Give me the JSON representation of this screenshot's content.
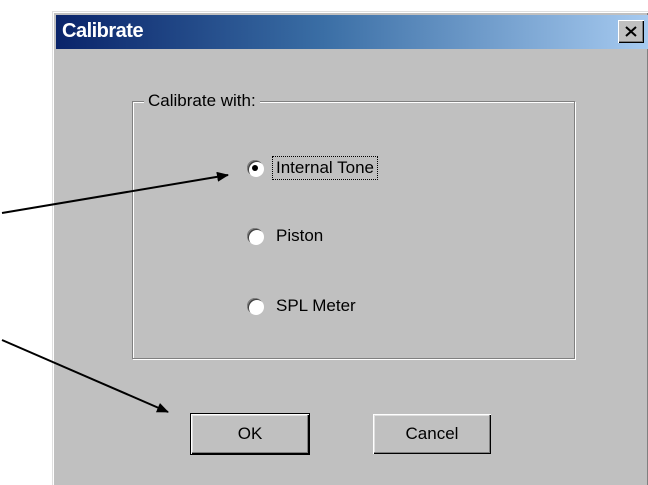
{
  "window": {
    "title": "Calibrate",
    "close_icon": "close-icon"
  },
  "group": {
    "label": "Calibrate with:",
    "options": [
      {
        "label": "Internal Tone",
        "selected": true
      },
      {
        "label": "Piston",
        "selected": false
      },
      {
        "label": "SPL Meter",
        "selected": false
      }
    ]
  },
  "buttons": {
    "ok_label": "OK",
    "cancel_label": "Cancel"
  },
  "colors": {
    "title_start": "#0a246a",
    "title_end": "#a6caf0",
    "face": "#c0c0c0"
  }
}
